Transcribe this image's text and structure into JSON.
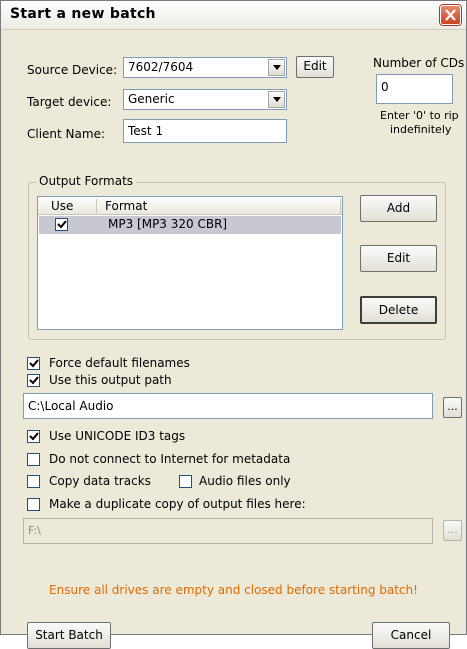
{
  "window": {
    "title": "Start a new batch",
    "close_icon": "close-icon"
  },
  "source": {
    "label": "Source Device:",
    "value": "7602/7604",
    "edit_label": "Edit"
  },
  "target": {
    "label": "Target device:",
    "value": "Generic"
  },
  "client": {
    "label": "Client Name:",
    "value": "Test 1"
  },
  "cds": {
    "label": "Number of CDs",
    "value": "0",
    "hint_line1": "Enter '0' to rip",
    "hint_line2": "indefinitely"
  },
  "output_formats": {
    "group_label": "Output Formats",
    "columns": [
      "Use",
      "Format"
    ],
    "rows": [
      {
        "use": true,
        "format": "MP3 [MP3 320 CBR]"
      }
    ],
    "add_label": "Add",
    "edit_label": "Edit",
    "delete_label": "Delete"
  },
  "options": {
    "force_default": {
      "label": "Force default filenames",
      "checked": true
    },
    "use_output_path": {
      "label": "Use this output path",
      "checked": true
    },
    "output_path": "C:\\Local Audio",
    "unicode_id3": {
      "label": "Use UNICODE ID3 tags",
      "checked": true
    },
    "no_internet": {
      "label": "Do not connect to Internet for metadata",
      "checked": false
    },
    "copy_data": {
      "label": "Copy data tracks",
      "checked": false
    },
    "audio_only": {
      "label": "Audio files only",
      "checked": false
    },
    "duplicate": {
      "label": "Make a duplicate copy of output files here:",
      "checked": false
    },
    "duplicate_path": "F:\\",
    "browse_label": "..."
  },
  "warning": "Ensure all drives are empty and closed before starting batch!",
  "actions": {
    "start_label": "Start Batch",
    "cancel_label": "Cancel"
  },
  "colors": {
    "dialog_bg": "#ece9d8",
    "warning_text": "#e06a00",
    "selected_row": "#c8c8d2",
    "close_button": "#c84320"
  }
}
